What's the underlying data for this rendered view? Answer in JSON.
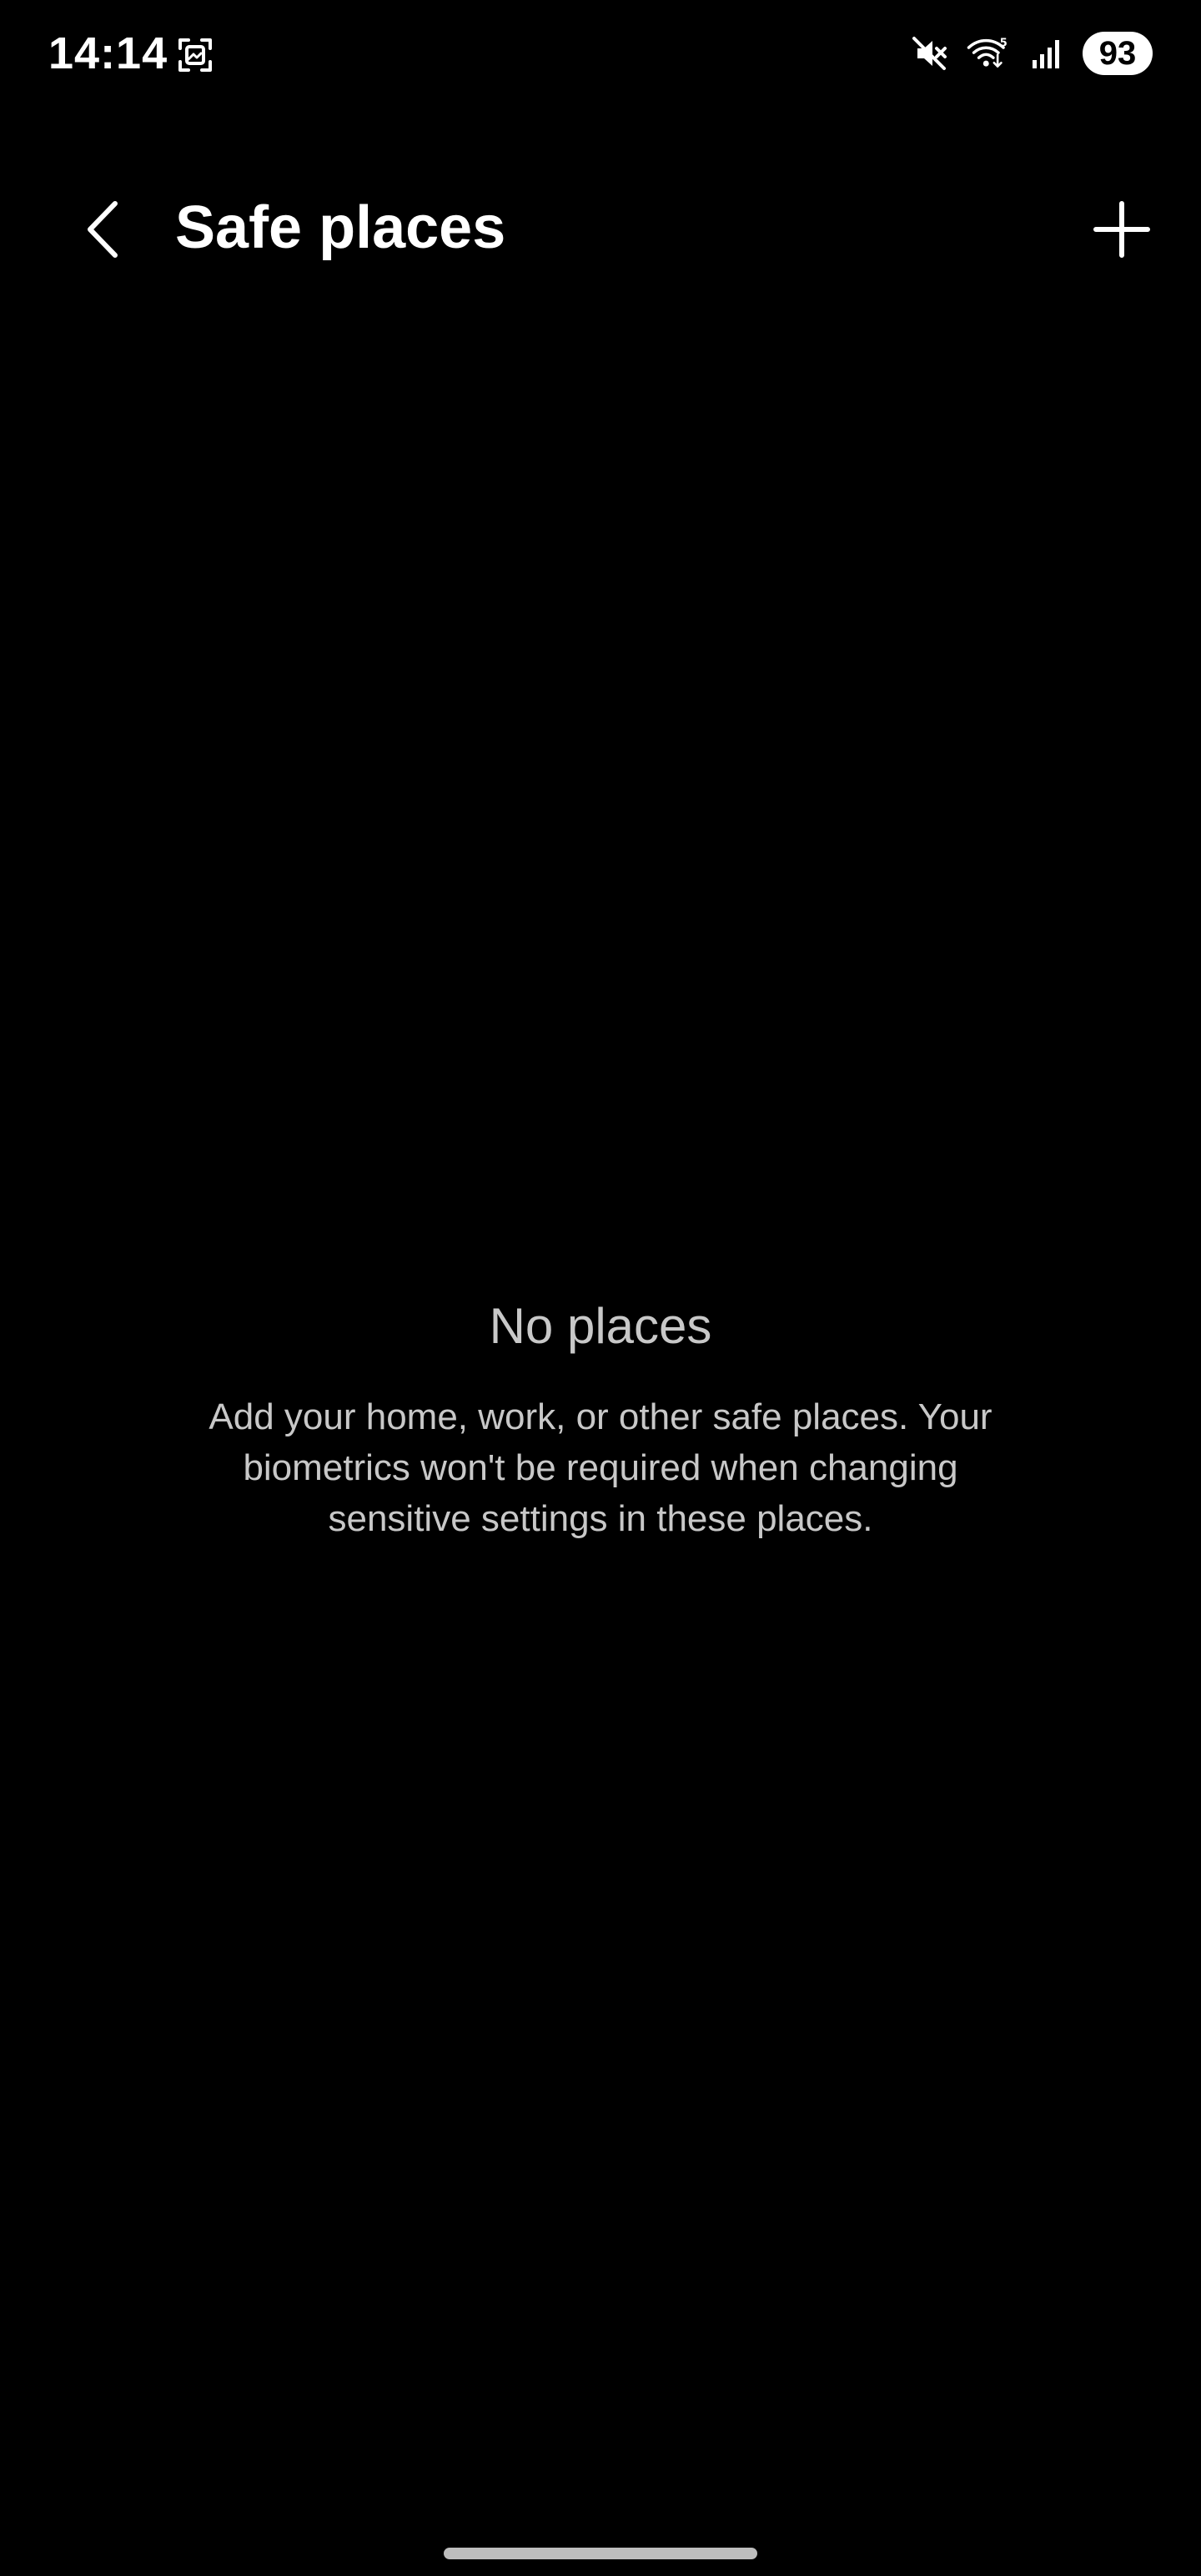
{
  "colors": {
    "background": "#000000",
    "primary_text": "#ffffff",
    "secondary_text": "#c8c8c8",
    "battery_pill": "#ffffff",
    "battery_text": "#000000",
    "nav_handle": "#bdbdbd"
  },
  "status_bar": {
    "time": "14:14",
    "battery_level": "93",
    "icons": [
      "screenshot-icon",
      "mute-icon",
      "wifi-icon",
      "signal-icon"
    ],
    "wifi_badge": "5"
  },
  "app_bar": {
    "title": "Safe places",
    "back_icon": "chevron-left-icon",
    "add_icon": "plus-icon"
  },
  "empty_state": {
    "title": "No places",
    "description": "Add your home, work, or other safe places. Your biometrics won't be required when changing sensitive settings in these places."
  }
}
